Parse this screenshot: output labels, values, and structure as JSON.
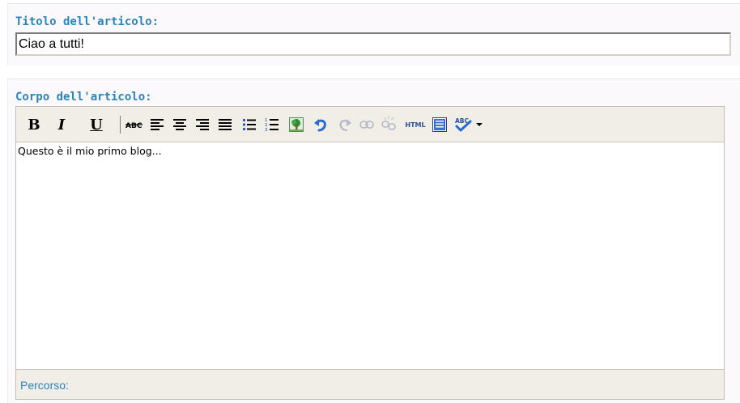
{
  "post_title": {
    "label": "Titolo dell'articolo:",
    "value": "Ciao a tutti!"
  },
  "post_body": {
    "label": "Corpo dell'articolo:",
    "content": "Questo è il mio primo blog...",
    "path_label": "Percorso:"
  },
  "toolbar": {
    "bold": "B",
    "italic": "I",
    "underline": "U",
    "html": "HTML",
    "buttons": [
      {
        "name": "bold",
        "enabled": true
      },
      {
        "name": "italic",
        "enabled": true
      },
      {
        "name": "underline",
        "enabled": true
      },
      {
        "name": "strikethrough",
        "enabled": true
      },
      {
        "name": "align-left",
        "enabled": true
      },
      {
        "name": "align-center",
        "enabled": true
      },
      {
        "name": "align-right",
        "enabled": true
      },
      {
        "name": "align-justify",
        "enabled": true
      },
      {
        "name": "bullet-list",
        "enabled": true
      },
      {
        "name": "numbered-list",
        "enabled": true
      },
      {
        "name": "insert-image",
        "enabled": true
      },
      {
        "name": "undo",
        "enabled": true
      },
      {
        "name": "redo",
        "enabled": false
      },
      {
        "name": "insert-link",
        "enabled": false
      },
      {
        "name": "remove-link",
        "enabled": false
      },
      {
        "name": "html-source",
        "enabled": true
      },
      {
        "name": "insert-template",
        "enabled": true
      },
      {
        "name": "spellcheck",
        "enabled": true
      }
    ]
  },
  "colors": {
    "label": "#2a84bb",
    "toolbar_bg": "#f0eee6",
    "disabled_icon": "#b4b8c8"
  }
}
